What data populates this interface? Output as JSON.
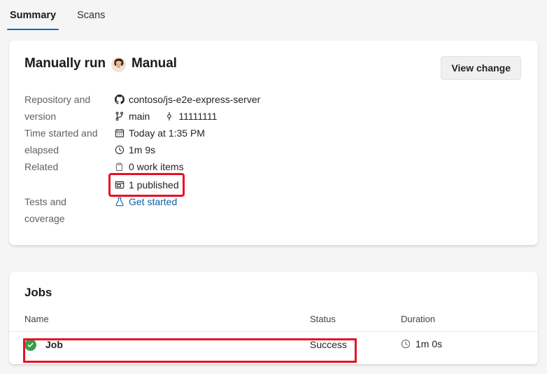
{
  "tabs": [
    {
      "label": "Summary",
      "active": true
    },
    {
      "label": "Scans",
      "active": false
    }
  ],
  "summary": {
    "run_title": "Manually run",
    "trigger_name": "Manual",
    "avatar_name": "user-avatar",
    "view_change_label": "View change",
    "details": [
      {
        "label": "Repository and version",
        "values": [
          {
            "icon": "github-icon",
            "text": "contoso/js-e2e-express-server"
          },
          {
            "icon": "branch-icon",
            "text": "main",
            "icon2": "commit-icon",
            "text2": "11111111"
          }
        ]
      },
      {
        "label": "Time started and elapsed",
        "values": [
          {
            "icon": "calendar-icon",
            "text": "Today at 1:35 PM"
          },
          {
            "icon": "clock-icon",
            "text": "1m 9s"
          }
        ]
      },
      {
        "label": "Related",
        "values": [
          {
            "icon": "clipboard-icon",
            "text": "0 work items"
          },
          {
            "icon": "artifact-icon",
            "text": "1 published",
            "highlighted": true
          }
        ]
      },
      {
        "label": "Tests and coverage",
        "values": [
          {
            "icon": "beaker-icon",
            "text": "Get started",
            "link": true
          }
        ]
      }
    ]
  },
  "jobs": {
    "title": "Jobs",
    "columns": {
      "name": "Name",
      "status": "Status",
      "duration": "Duration"
    },
    "rows": [
      {
        "status_icon": "success-check-icon",
        "name": "Job",
        "status": "Success",
        "duration_icon": "clock-icon",
        "duration": "1m 0s",
        "highlighted": true
      }
    ]
  },
  "colors": {
    "accent": "#0f6cbd",
    "link": "#115ea3",
    "success": "#3a9b4d",
    "highlight": "#e81123",
    "page_background": "#f5f5f5",
    "card_background": "#ffffff"
  }
}
